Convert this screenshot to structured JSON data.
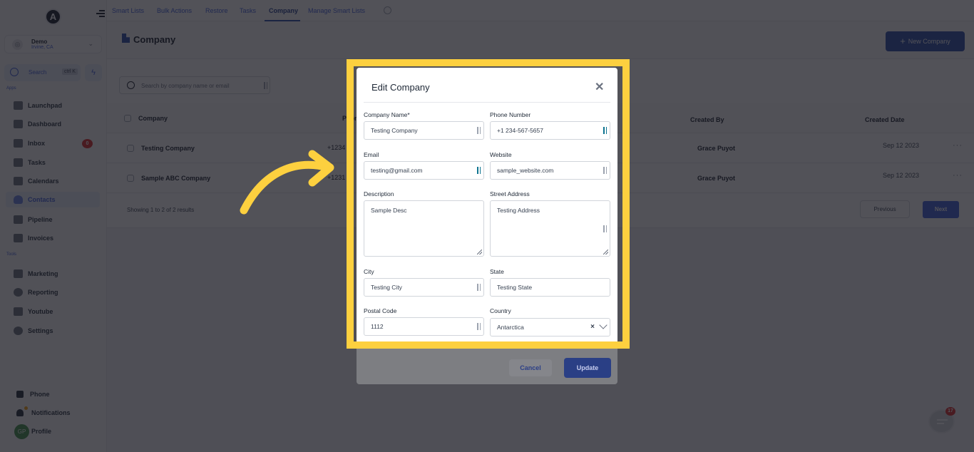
{
  "sidebar": {
    "logo_letter": "A",
    "account": {
      "name": "Demo",
      "location": "Irvine, CA",
      "avatar_icon": "user-circle-icon"
    },
    "search": {
      "label": "Search",
      "shortcut": "ctrl K"
    },
    "quick_action_icon": "lightning-bolt-icon",
    "apps_label": "Apps",
    "apps": [
      {
        "label": "Launchpad",
        "icon": "rocket-icon"
      },
      {
        "label": "Dashboard",
        "icon": "grid-icon"
      },
      {
        "label": "Inbox",
        "icon": "inbox-icon",
        "badge": "0"
      },
      {
        "label": "Tasks",
        "icon": "clipboard-icon"
      },
      {
        "label": "Calendars",
        "icon": "calendar-icon"
      },
      {
        "label": "Contacts",
        "icon": "user-icon",
        "active": true
      },
      {
        "label": "Pipeline",
        "icon": "funnel-icon"
      },
      {
        "label": "Invoices",
        "icon": "invoice-icon"
      }
    ],
    "tools_label": "Tools",
    "tools": [
      {
        "label": "Marketing",
        "icon": "megaphone-icon"
      },
      {
        "label": "Reporting",
        "icon": "pie-chart-icon"
      },
      {
        "label": "Youtube",
        "icon": "youtube-icon"
      },
      {
        "label": "Settings",
        "icon": "gear-icon"
      }
    ],
    "bottom": {
      "phone": "Phone",
      "notifications": "Notifications",
      "profile": "Profile",
      "profile_initials": "GP"
    }
  },
  "topbar": {
    "tabs": [
      {
        "label": "Smart Lists"
      },
      {
        "label": "Bulk Actions"
      },
      {
        "label": "Restore"
      },
      {
        "label": "Tasks"
      },
      {
        "label": "Company",
        "active": true
      },
      {
        "label": "Manage Smart Lists"
      }
    ]
  },
  "page": {
    "title": "Company",
    "new_button": "New Company",
    "search_placeholder": "Search by company name or email",
    "table": {
      "columns": [
        "Company",
        "Phone",
        "Created By",
        "Created Date"
      ],
      "rows": [
        {
          "company": "Testing Company",
          "phone": "+1234",
          "created_by": "Grace Puyot",
          "created_date": "Sep 12 2023"
        },
        {
          "company": "Sample ABC Company",
          "phone": "+1231",
          "created_by": "Grace Puyot",
          "created_date": "Sep 12 2023"
        }
      ]
    },
    "results_text": "Showing 1 to 2 of 2 results",
    "previous": "Previous",
    "next": "Next"
  },
  "chat_widget": {
    "badge": "17"
  },
  "modal": {
    "title": "Edit Company",
    "fields": {
      "company_name": {
        "label": "Company Name*",
        "value": "Testing Company"
      },
      "phone": {
        "label": "Phone Number",
        "value": "+1 234-567-5657"
      },
      "email": {
        "label": "Email",
        "value": "testing@gmail.com"
      },
      "website": {
        "label": "Website",
        "value": "sample_website.com"
      },
      "description": {
        "label": "Description",
        "value": "Sample Desc"
      },
      "street": {
        "label": "Street Address",
        "value": "Testing Address"
      },
      "city": {
        "label": "City",
        "value": "Testing City"
      },
      "state": {
        "label": "State",
        "value": "Testing State"
      },
      "postal": {
        "label": "Postal Code",
        "value": "1112"
      },
      "country": {
        "label": "Country",
        "value": "Antarctica"
      }
    },
    "cancel": "Cancel",
    "update": "Update"
  },
  "annotation": {
    "highlight_color": "#fdd03f"
  }
}
